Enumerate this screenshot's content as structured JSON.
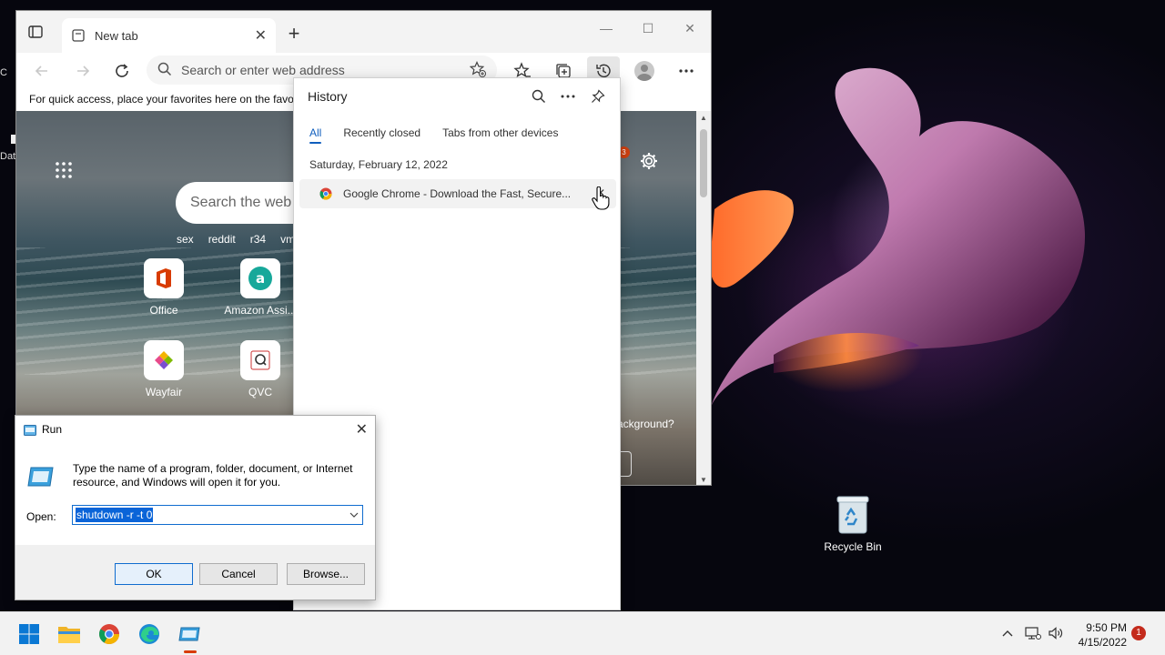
{
  "desktop": {
    "left_edge_items": [
      "C",
      "Dat"
    ],
    "recycle_bin_label": "Recycle Bin"
  },
  "browser": {
    "tab_title": "New tab",
    "address_placeholder": "Search or enter web address",
    "favorites_bar_text": "For quick access, place your favorites here on the favo",
    "ntp": {
      "search_placeholder": "Search the web",
      "quick_links": [
        "sex",
        "reddit",
        "r34",
        "vmv"
      ],
      "tiles": [
        "Office",
        "Amazon Assi...",
        "Wayfair",
        "QVC"
      ],
      "notification_count": "3",
      "background_prompt": "ackground?"
    }
  },
  "history": {
    "title": "History",
    "tabs": [
      "All",
      "Recently closed",
      "Tabs from other devices"
    ],
    "active_tab": "All",
    "date_header": "Saturday, February 12, 2022",
    "items": [
      {
        "title": "Google Chrome - Download the Fast, Secure..."
      }
    ]
  },
  "run_dialog": {
    "title": "Run",
    "description": "Type the name of a program, folder, document, or Internet resource, and Windows will open it for you.",
    "open_label": "Open:",
    "command_value": "shutdown -r -t 0",
    "buttons": {
      "ok": "OK",
      "cancel": "Cancel",
      "browse": "Browse..."
    }
  },
  "taskbar": {
    "time": "9:50 PM",
    "date": "4/15/2022",
    "notification_count": "1"
  },
  "colors": {
    "accent_blue": "#0f5ebd",
    "selection_blue": "#0a64d8",
    "notification_red": "#c42b1c"
  }
}
